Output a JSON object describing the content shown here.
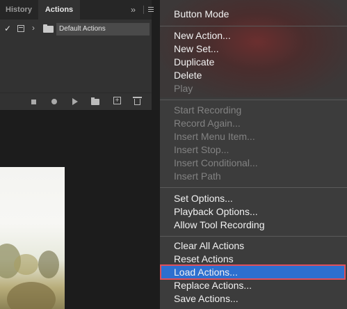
{
  "panel": {
    "tabs": [
      {
        "label": "History"
      },
      {
        "label": "Actions"
      }
    ],
    "collapse_glyph": "››",
    "action_set": {
      "checked": true,
      "name": "Default Actions"
    },
    "footer_icons": [
      "stop-icon",
      "record-icon",
      "play-icon",
      "new-set-icon",
      "new-action-icon",
      "trash-icon"
    ]
  },
  "menu": {
    "items": [
      {
        "label": "Button Mode",
        "enabled": true
      },
      {
        "label": "New Action...",
        "enabled": true
      },
      {
        "label": "New Set...",
        "enabled": true
      },
      {
        "label": "Duplicate",
        "enabled": true
      },
      {
        "label": "Delete",
        "enabled": true
      },
      {
        "label": "Play",
        "enabled": false
      },
      {
        "label": "Start Recording",
        "enabled": false
      },
      {
        "label": "Record Again...",
        "enabled": false
      },
      {
        "label": "Insert Menu Item...",
        "enabled": false
      },
      {
        "label": "Insert Stop...",
        "enabled": false
      },
      {
        "label": "Insert Conditional...",
        "enabled": false
      },
      {
        "label": "Insert Path",
        "enabled": false
      },
      {
        "label": "Set Options...",
        "enabled": true
      },
      {
        "label": "Playback Options...",
        "enabled": true
      },
      {
        "label": "Allow Tool Recording",
        "enabled": true
      },
      {
        "label": "Clear All Actions",
        "enabled": true
      },
      {
        "label": "Reset Actions",
        "enabled": true
      },
      {
        "label": "Load Actions...",
        "enabled": true,
        "highlighted": true
      },
      {
        "label": "Replace Actions...",
        "enabled": true
      },
      {
        "label": "Save Actions...",
        "enabled": true
      }
    ],
    "highlight_color": "#2d6fcf",
    "highlight_outline_color": "#e0505a"
  }
}
